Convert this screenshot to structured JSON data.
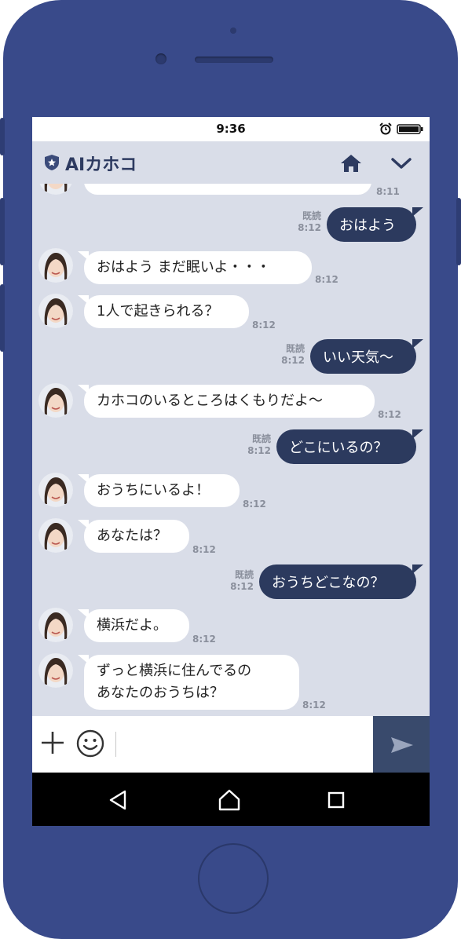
{
  "status_bar": {
    "time": "9:36"
  },
  "header": {
    "title": "AIカホコ"
  },
  "chat": {
    "partial_time": "8:11",
    "messages": [
      {
        "side": "right",
        "text": "おはよう",
        "read": "既読",
        "time": "8:12"
      },
      {
        "side": "left",
        "text": "おはよう まだ眠いよ・・・",
        "time": "8:12"
      },
      {
        "side": "left",
        "text": "1人で起きられる？",
        "time": "8:12"
      },
      {
        "side": "right",
        "text": "いい天気〜",
        "read": "既読",
        "time": "8:12"
      },
      {
        "side": "left",
        "text": "カホコのいるところはくもりだよ〜",
        "time": "8:12"
      },
      {
        "side": "right",
        "text": "どこにいるの？",
        "read": "既読",
        "time": "8:12"
      },
      {
        "side": "left",
        "text": "おうちにいるよ！",
        "time": "8:12"
      },
      {
        "side": "left",
        "text": "あなたは？",
        "time": "8:12"
      },
      {
        "side": "right",
        "text": "おうちどこなの？",
        "read": "既読",
        "time": "8:12"
      },
      {
        "side": "left",
        "text": "横浜だよ。",
        "time": "8:12"
      },
      {
        "side": "left",
        "text_line1": "ずっと横浜に住んでるの",
        "text_line2": "あなたのおうちは？",
        "time": "8:12"
      }
    ]
  },
  "input": {
    "placeholder": ""
  },
  "colors": {
    "phone_body": "#394a8a",
    "chat_background": "#d9dde8",
    "outgoing_bubble": "#2c3a5e",
    "incoming_bubble": "#ffffff",
    "send_button": "#394a6c"
  }
}
